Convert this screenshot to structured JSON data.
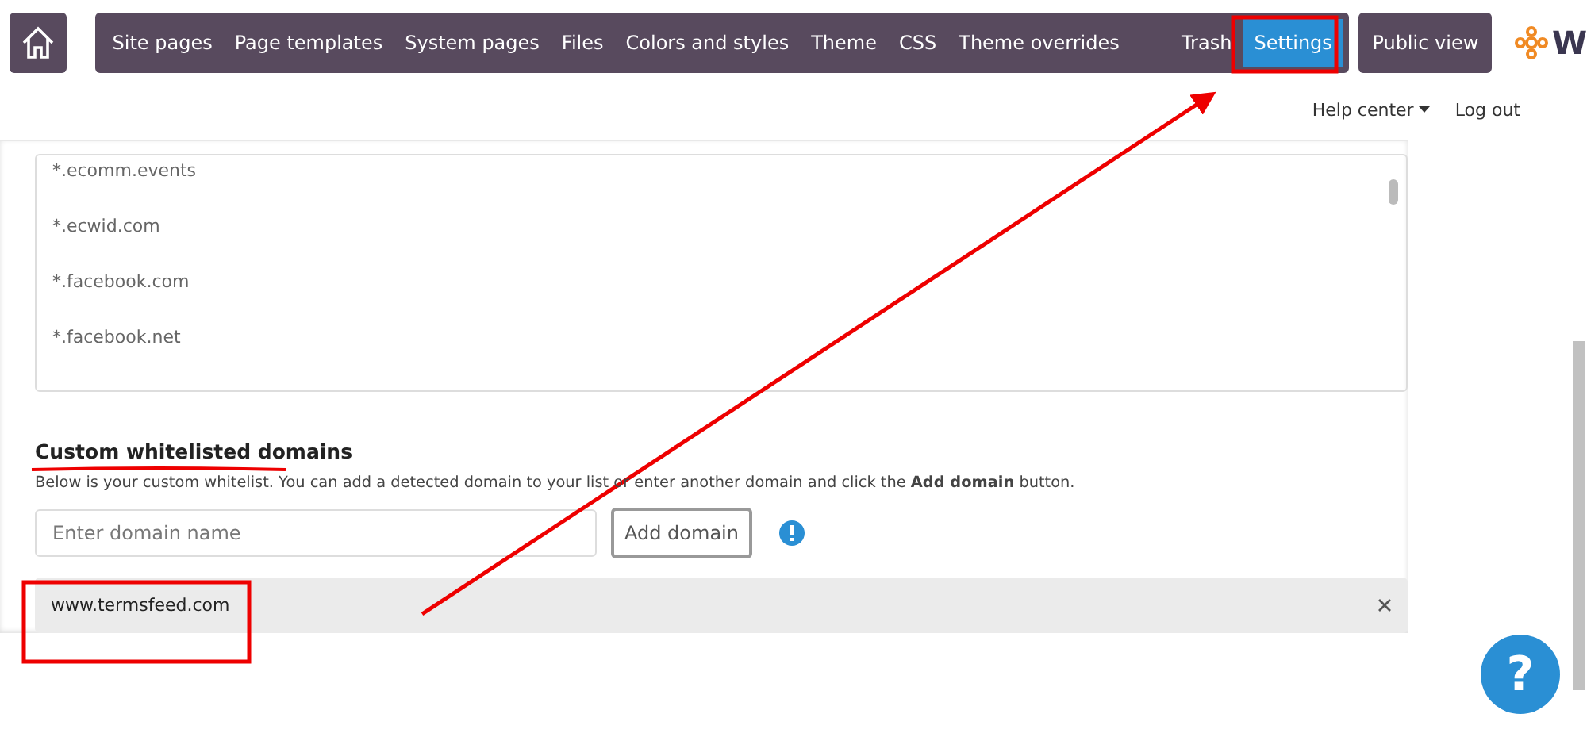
{
  "nav": {
    "items": [
      {
        "label": "Site pages",
        "selected": false
      },
      {
        "label": "Page templates",
        "selected": false
      },
      {
        "label": "System pages",
        "selected": false
      },
      {
        "label": "Files",
        "selected": false
      },
      {
        "label": "Colors and styles",
        "selected": false
      },
      {
        "label": "Theme",
        "selected": false
      },
      {
        "label": "CSS",
        "selected": false
      },
      {
        "label": "Theme overrides",
        "selected": false
      },
      {
        "label": "Trash",
        "selected": false
      },
      {
        "label": "Settings",
        "selected": true
      }
    ],
    "public_view": "Public view",
    "logo_text": "W"
  },
  "user_menu": {
    "help_center": "Help center",
    "log_out": "Log out"
  },
  "detected_domains": [
    "*.ecomm.events",
    "*.ecwid.com",
    "*.facebook.com",
    "*.facebook.net"
  ],
  "custom": {
    "heading": "Custom whitelisted domains",
    "description": "Below is your custom whitelist. You can add a detected domain to your list or enter another domain and click the **Add domain** button.",
    "input": {
      "placeholder": "Enter domain name"
    },
    "add_button": "Add domain",
    "domains": [
      "www.termsfeed.com"
    ]
  },
  "help_button": "?"
}
